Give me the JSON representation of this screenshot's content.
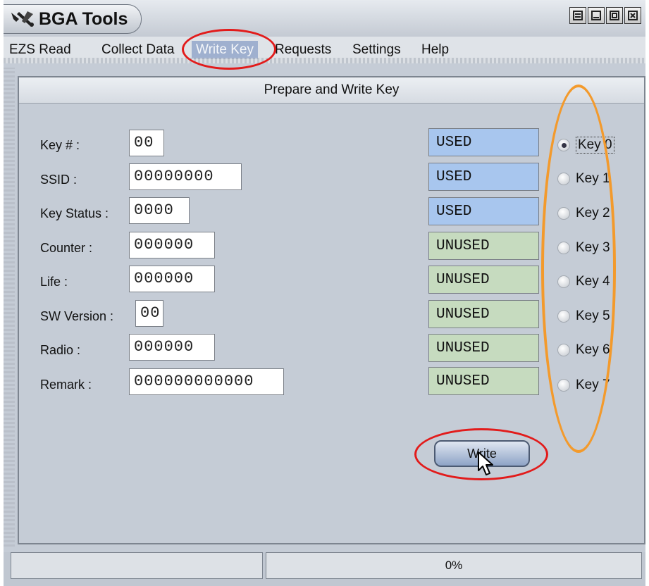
{
  "app": {
    "title": "BGA Tools",
    "logo_icon": "wrench-tools-icon"
  },
  "window_controls": [
    "window-menu-icon",
    "minimize-icon",
    "maximize-icon",
    "close-icon"
  ],
  "menu": {
    "items": [
      "EZS Read",
      "Collect Data",
      "Write Key",
      "Requests",
      "Settings",
      "Help"
    ],
    "active": "Write Key"
  },
  "panel": {
    "header": "Prepare and Write Key"
  },
  "fields": [
    {
      "label": "Key # :",
      "value": "00"
    },
    {
      "label": "SSID :",
      "value": "00000000"
    },
    {
      "label": "Key Status :",
      "value": "0000"
    },
    {
      "label": "Counter :",
      "value": "000000"
    },
    {
      "label": "Life :",
      "value": "000000"
    },
    {
      "label": "SW Version :",
      "value": "00"
    },
    {
      "label": "Radio :",
      "value": "000000"
    },
    {
      "label": "Remark :",
      "value": "000000000000"
    }
  ],
  "key_status": [
    "USED",
    "USED",
    "USED",
    "UNUSED",
    "UNUSED",
    "UNUSED",
    "UNUSED",
    "UNUSED"
  ],
  "keys": {
    "options": [
      "Key 0",
      "Key 1",
      "Key 2",
      "Key 3",
      "Key 4",
      "Key 5",
      "Key 6",
      "Key 7"
    ],
    "selected": "Key 0"
  },
  "write_button": "Write",
  "statusbar": {
    "left": "",
    "progress": "0%"
  },
  "colors": {
    "used": "#a8c6ee",
    "unused": "#c6dbbf",
    "annotation_red": "#e21b1b",
    "annotation_orange": "#f39a2c"
  }
}
